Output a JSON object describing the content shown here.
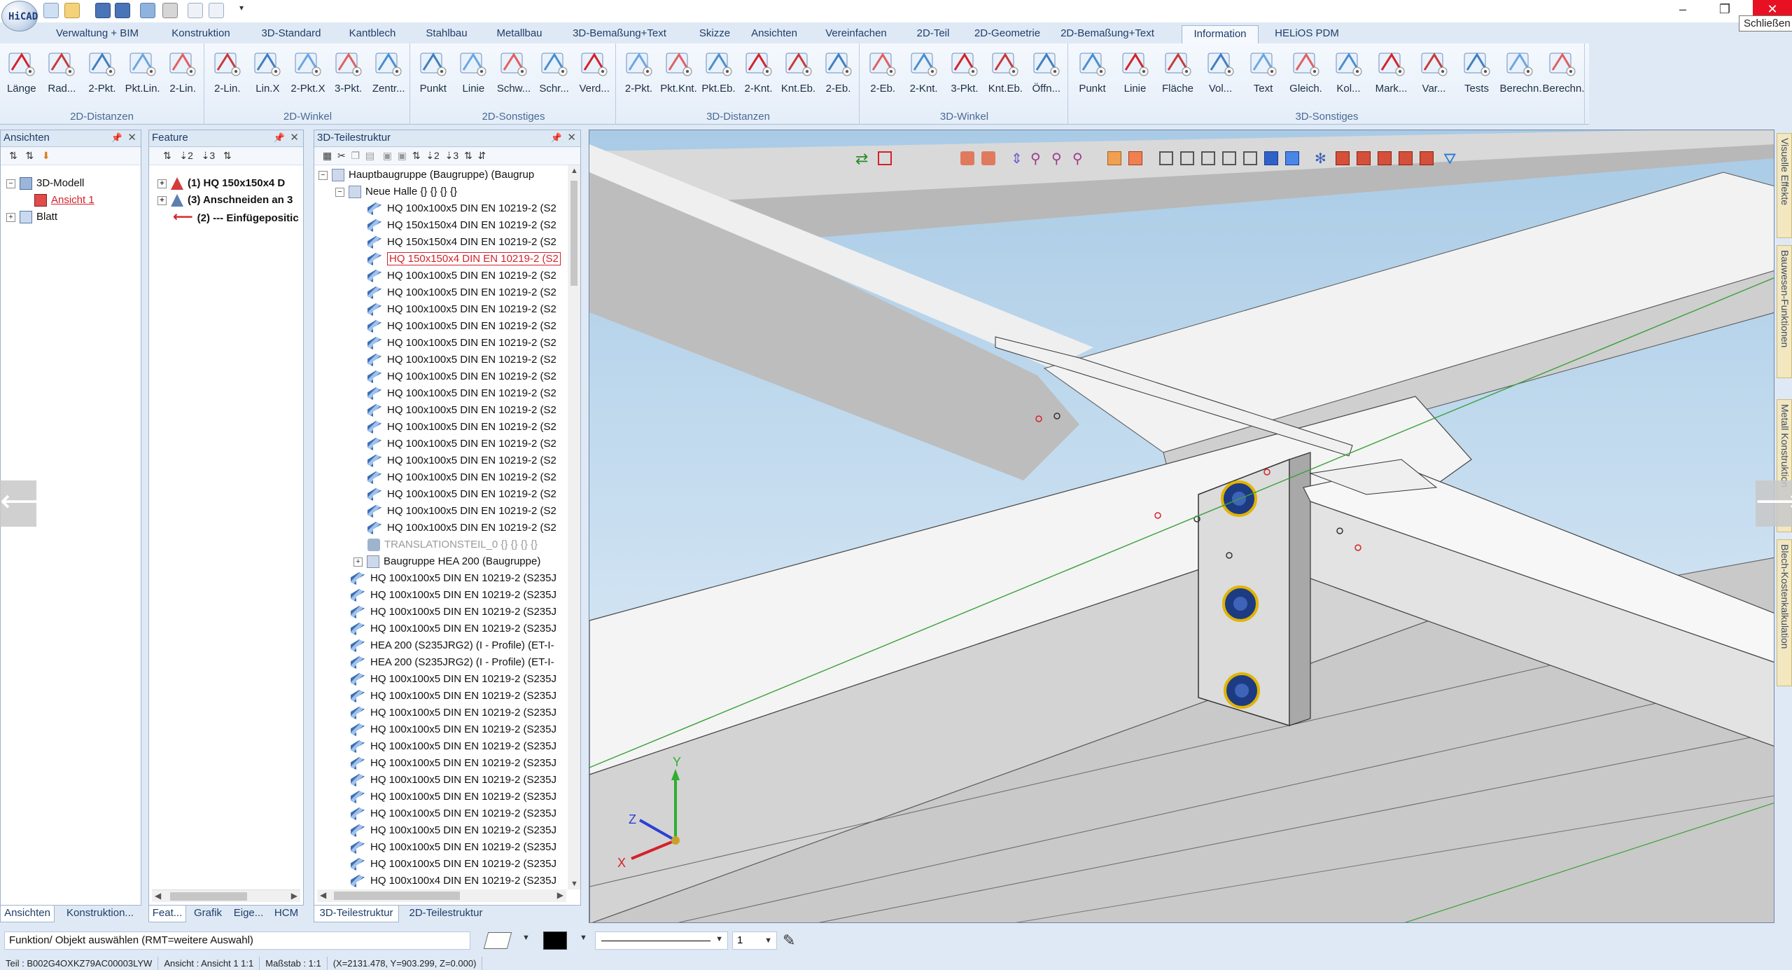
{
  "quick_access": {
    "icons": [
      "new-file-icon",
      "open-icon",
      "save-icon",
      "save-as-icon",
      "export-icon",
      "print-icon",
      "undo-icon",
      "redo-icon",
      "customize-icon"
    ]
  },
  "window": {
    "close_tooltip": "Schließen",
    "minimize_glyph": "–",
    "restore_glyph": "❐",
    "close_glyph": "✕"
  },
  "tabs": [
    "Verwaltung + BIM",
    "Konstruktion",
    "3D-Standard",
    "Kantblech",
    "Stahlbau",
    "Metallbau",
    "3D-Bemaßung+Text",
    "Skizze",
    "Ansichten",
    "Vereinfachen",
    "2D-Teil",
    "2D-Geometrie",
    "2D-Bemaßung+Text",
    "Information",
    "HELiOS PDM"
  ],
  "active_tab": "Information",
  "ribbon": {
    "groups": [
      {
        "label": "2D-Distanzen",
        "buttons": [
          "Länge",
          "Rad...",
          "2-Pkt.",
          "Pkt.Lin.",
          "2-Lin."
        ]
      },
      {
        "label": "2D-Winkel",
        "buttons": [
          "2-Lin.",
          "Lin.X",
          "2-Pkt.X",
          "3-Pkt.",
          "Zentr..."
        ]
      },
      {
        "label": "2D-Sonstiges",
        "buttons": [
          "Punkt",
          "Linie",
          "Schw...",
          "Schr...",
          "Verd..."
        ]
      },
      {
        "label": "3D-Distanzen",
        "buttons": [
          "2-Pkt.",
          "Pkt.Knt.",
          "Pkt.Eb.",
          "2-Knt.",
          "Knt.Eb.",
          "2-Eb."
        ]
      },
      {
        "label": "3D-Winkel",
        "buttons": [
          "2-Eb.",
          "2-Knt.",
          "3-Pkt.",
          "Knt.Eb.",
          "Öffn..."
        ]
      },
      {
        "label": "3D-Sonstiges",
        "buttons": [
          "Punkt",
          "Linie",
          "Fläche",
          "Vol...",
          "Text",
          "Gleich.",
          "Kol...",
          "Mark...",
          "Var...",
          "Tests",
          "Berechn.",
          "Berechn."
        ]
      }
    ]
  },
  "panels": {
    "ansichten": {
      "title": "Ansichten",
      "tree": [
        {
          "label": "3D-Modell",
          "level": 0
        },
        {
          "label": "Ansicht 1",
          "level": 1
        },
        {
          "label": "Blatt",
          "level": 0
        }
      ]
    },
    "feature": {
      "title": "Feature",
      "tree": [
        {
          "label": "(1) HQ 150x150x4 D"
        },
        {
          "label": "(3) Anschneiden an 3"
        },
        {
          "label": "(2) --- Einfügepositic"
        }
      ]
    },
    "teilestruktur": {
      "title": "3D-Teilestruktur",
      "root": "Hauptbaugruppe (Baugruppe) (Baugrup",
      "group": "Neue Halle {} {} {} {}",
      "items": [
        "HQ 100x100x5 DIN EN 10219-2 (S2",
        "HQ 150x150x4 DIN EN 10219-2 (S2",
        "HQ 150x150x4 DIN EN 10219-2 (S2",
        "HQ 150x150x4 DIN EN 10219-2 (S2",
        "HQ 100x100x5 DIN EN 10219-2 (S2",
        "HQ 100x100x5 DIN EN 10219-2 (S2",
        "HQ 100x100x5 DIN EN 10219-2 (S2",
        "HQ 100x100x5 DIN EN 10219-2 (S2",
        "HQ 100x100x5 DIN EN 10219-2 (S2",
        "HQ 100x100x5 DIN EN 10219-2 (S2",
        "HQ 100x100x5 DIN EN 10219-2 (S2",
        "HQ 100x100x5 DIN EN 10219-2 (S2",
        "HQ 100x100x5 DIN EN 10219-2 (S2",
        "HQ 100x100x5 DIN EN 10219-2 (S2",
        "HQ 100x100x5 DIN EN 10219-2 (S2",
        "HQ 100x100x5 DIN EN 10219-2 (S2",
        "HQ 100x100x5 DIN EN 10219-2 (S2",
        "HQ 100x100x5 DIN EN 10219-2 (S2",
        "HQ 100x100x5 DIN EN 10219-2 (S2",
        "HQ 100x100x5 DIN EN 10219-2 (S2"
      ],
      "selected_index": 3,
      "translation": "TRANSLATIONSTEIL_0 {} {} {} {}",
      "subgroup": "Baugruppe HEA 200 (Baugruppe)",
      "lower_items": [
        "HQ 100x100x5 DIN EN 10219-2 (S235J",
        "HQ 100x100x5 DIN EN 10219-2 (S235J",
        "HQ 100x100x5 DIN EN 10219-2 (S235J",
        "HQ 100x100x5 DIN EN 10219-2 (S235J",
        "HEA 200 (S235JRG2) (I - Profile) (ET-I-",
        "HEA 200 (S235JRG2) (I - Profile) (ET-I-",
        "HQ 100x100x5 DIN EN 10219-2 (S235J",
        "HQ 100x100x5 DIN EN 10219-2 (S235J",
        "HQ 100x100x5 DIN EN 10219-2 (S235J",
        "HQ 100x100x5 DIN EN 10219-2 (S235J",
        "HQ 100x100x5 DIN EN 10219-2 (S235J",
        "HQ 100x100x5 DIN EN 10219-2 (S235J",
        "HQ 100x100x5 DIN EN 10219-2 (S235J",
        "HQ 100x100x5 DIN EN 10219-2 (S235J",
        "HQ 100x100x5 DIN EN 10219-2 (S235J",
        "HQ 100x100x5 DIN EN 10219-2 (S235J",
        "HQ 100x100x5 DIN EN 10219-2 (S235J",
        "HQ 100x100x5 DIN EN 10219-2 (S235J",
        "HQ 100x100x4 DIN EN 10219-2 (S235J"
      ]
    }
  },
  "bottom_tabs": {
    "left": [
      "Ansichten",
      "Konstruktion..."
    ],
    "feature": [
      "Feat...",
      "Grafik",
      "Eige...",
      "HCM"
    ],
    "tree": [
      "3D-Teilestruktur",
      "2D-Teilestruktur"
    ]
  },
  "side_tabs": [
    "Visuelle Effekte",
    "Bauwesen-Funktionen",
    "Metall Konstruktion",
    "Blech-Kostenkalkulation"
  ],
  "command": {
    "prompt": "Funktion/ Objekt auswählen (RMT=weitere Auswahl)",
    "line_width": "1"
  },
  "status": {
    "teil": "Teil : B002G4OXKZ79AC00003LYW",
    "ansicht": "Ansicht : Ansicht 1 1:1",
    "massstab": "Maßstab : 1:1",
    "coords": "(X=2131.478, Y=903.299, Z=0.000)"
  },
  "axes": {
    "x": "X",
    "y": "Y",
    "z": "Z"
  },
  "colors": {
    "accent": "#1f3e6b",
    "selected": "#d4222a",
    "close_red": "#e81123"
  }
}
